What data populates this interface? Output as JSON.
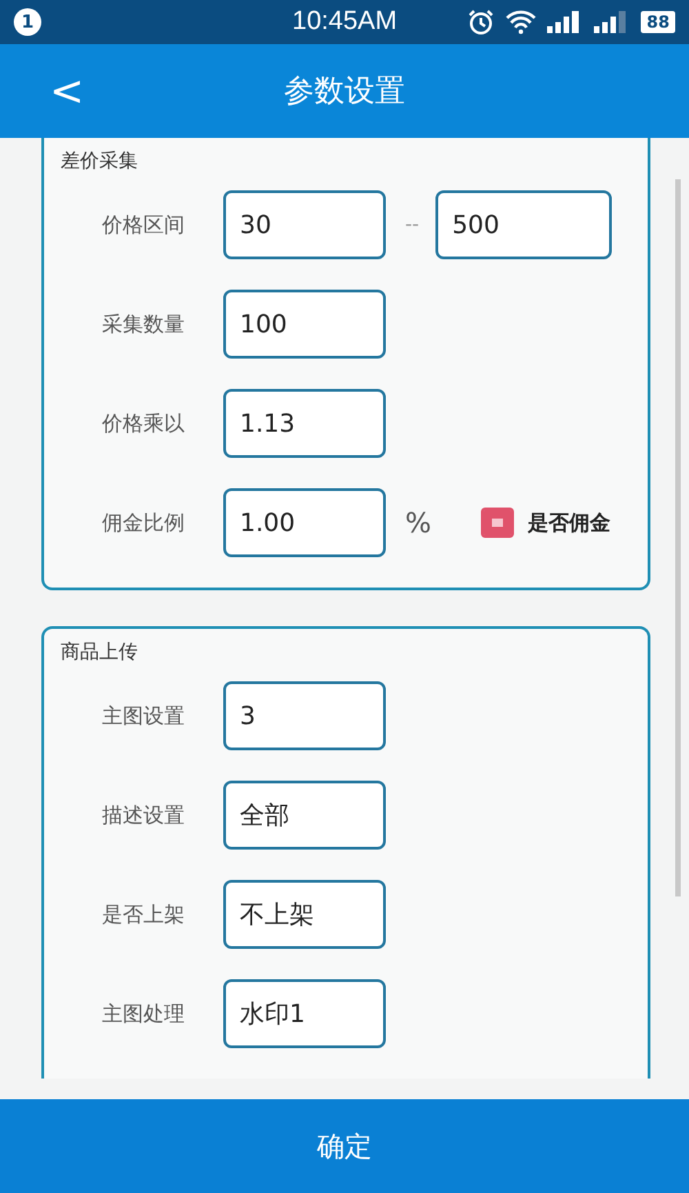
{
  "status_bar": {
    "notification_count": "1",
    "time": "10:45AM",
    "battery": "88"
  },
  "header": {
    "back": "<",
    "title": "参数设置"
  },
  "sections": [
    {
      "title": "差价采集",
      "rows": [
        {
          "label": "价格区间",
          "values": [
            "30",
            "500"
          ],
          "separator": "--"
        },
        {
          "label": "采集数量",
          "values": [
            "100"
          ]
        },
        {
          "label": "价格乘以",
          "values": [
            "1.13"
          ]
        },
        {
          "label": "佣金比例",
          "values": [
            "1.00"
          ],
          "unit": "%",
          "option": {
            "label": "是否佣金",
            "checked": true
          }
        }
      ]
    },
    {
      "title": "商品上传",
      "rows": [
        {
          "label": "主图设置",
          "values": [
            "3"
          ]
        },
        {
          "label": "描述设置",
          "values": [
            "全部"
          ]
        },
        {
          "label": "是否上架",
          "values": [
            "不上架"
          ]
        },
        {
          "label": "主图处理",
          "values": [
            "水印1"
          ]
        }
      ]
    }
  ],
  "confirm_button": "确定"
}
